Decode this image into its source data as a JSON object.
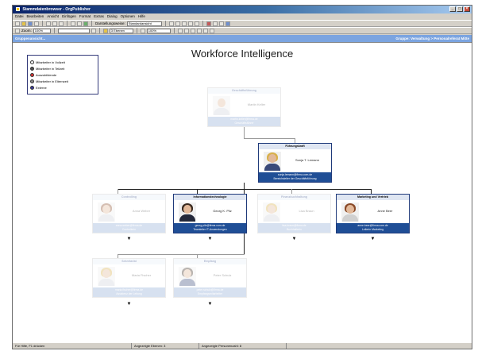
{
  "window": {
    "title": "Stammdatenbrowser - OrgPublisher",
    "min_glyph": "_",
    "max_glyph": "□",
    "close_glyph": "×"
  },
  "menu": [
    "Datei",
    "Bearbeiten",
    "Ansicht",
    "Einfügen",
    "Format",
    "Extras",
    "Dialog",
    "Optionen",
    "Hilfe"
  ],
  "toolbar1": {
    "layout_label": "Darstellungsweise:",
    "layout_value": "Standardansicht"
  },
  "toolbar2": {
    "zoom_label": "Zoom:",
    "zoom_value": "100%",
    "level_value": "3 Ebenen",
    "percent_value": "100%"
  },
  "groupbar": {
    "left": "Gruppenansicht...",
    "right": "Gruppe: Verwaltung > Personalreferat Mitte"
  },
  "canvas": {
    "title": "Workforce Intelligence"
  },
  "legend": [
    {
      "label": "Mitarbeiter in Vollzeit",
      "color": "#f4f4f4"
    },
    {
      "label": "Mitarbeiter in Teilzeit",
      "color": "#505050"
    },
    {
      "label": "Auszubildende",
      "color": "#d83030"
    },
    {
      "label": "Mitarbeiter in Elternzeit",
      "color": "#8a8a8a"
    },
    {
      "label": "Externe",
      "color": "#3a3a9a"
    }
  ],
  "cards": {
    "top": {
      "header": "Geschäftsführung",
      "name": "Martin Keller",
      "footer1": "martin.keller@firma.de",
      "footer2": "Geschäftsführer"
    },
    "leader": {
      "header": "Führungskraft",
      "name": "Sonja T. Lemann",
      "footer1": "sonja.lemann@firma.com.de",
      "footer2": "Bereichsleiter der Geschäftsführung"
    },
    "l3a": {
      "header": "Controlling",
      "name": "Anna Weber",
      "footer1": "anna.weber@firma.de",
      "footer2": "Controllerin"
    },
    "l3b": {
      "header": "Informationstechnologie",
      "name": "Georg K. Pilz",
      "footer1": "georg.pilz@firma.com.de",
      "footer2": "Teamleiter IT-Anwendungen"
    },
    "l3c": {
      "header": "Finanzbuchhaltung",
      "name": "Lisa Braun",
      "footer1": "lisa.braun@firma.de",
      "footer2": "Buchhalterin"
    },
    "l3d": {
      "header": "Marketing und Vertrieb",
      "name": "Anne Beer",
      "footer1": "anne.beer@firma.com.de",
      "footer2": "Leiterin Marketing"
    },
    "l4a": {
      "header": "Sekretariat",
      "name": "Maria Fischer",
      "footer1": "maria.fischer@firma.de",
      "footer2": "Assistenz der Leitung"
    },
    "l4b": {
      "header": "Empfang",
      "name": "Peter Schulz",
      "footer1": "peter.schulz@firma.de",
      "footer2": "Empfangsmitarbeiter"
    }
  },
  "expand_glyph": "▼",
  "status": {
    "help": "Für Hilfe, F1 drücken",
    "visible": "Angezeigte Ebenen: 3",
    "count": "Angezeigte Personenzahl: 8"
  }
}
